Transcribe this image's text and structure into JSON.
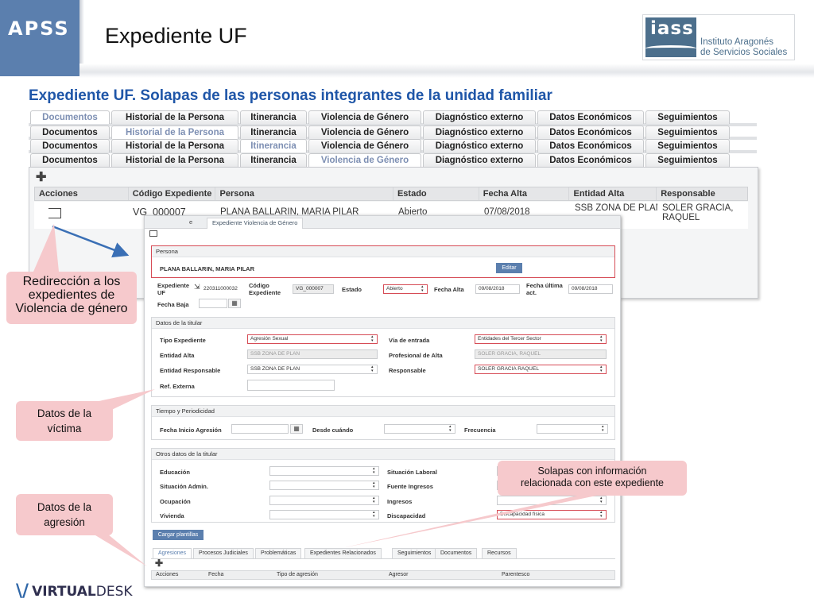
{
  "header": {
    "brand": "APSS",
    "title": "Expediente UF",
    "iass_logo_text": "iass",
    "iass_name_line1": "Instituto Aragonés",
    "iass_name_line2": "de Servicios Sociales"
  },
  "subtitle": "Expediente UF. Solapas de las personas integrantes de la unidad familiar",
  "tab_bars": [
    {
      "tabs": [
        "Documentos",
        "Historial de la Persona",
        "Itinerancia",
        "Violencia de Género",
        "Diagnóstico externo",
        "Datos Económicos",
        "Seguimientos"
      ],
      "active": 0
    },
    {
      "tabs": [
        "Documentos",
        "Historial de la Persona",
        "Itinerancia",
        "Violencia de Género",
        "Diagnóstico externo",
        "Datos Económicos",
        "Seguimientos"
      ],
      "active": 1
    },
    {
      "tabs": [
        "Documentos",
        "Historial de la Persona",
        "Itinerancia",
        "Violencia de Género",
        "Diagnóstico externo",
        "Datos Económicos",
        "Seguimientos"
      ],
      "active": 2
    },
    {
      "tabs": [
        "Documentos",
        "Historial de la Persona",
        "Itinerancia",
        "Violencia de Género",
        "Diagnóstico externo",
        "Datos Económicos",
        "Seguimientos"
      ],
      "active": 3
    }
  ],
  "grid": {
    "columns": [
      "Acciones",
      "Código Expediente",
      "Persona",
      "Estado",
      "Fecha Alta",
      "Entidad Alta",
      "Responsable"
    ],
    "row": {
      "codigo": "VG_000007",
      "persona": "PLANA BALLARIN, MARIA PILAR",
      "estado": "Abierto",
      "fecha_alta": "07/08/2018",
      "entidad_alta": "SSB ZONA DE PLAN",
      "responsable_1": "SOLER GRACIA,",
      "responsable_2": "RAQUEL"
    }
  },
  "form": {
    "tabs": [
      "e",
      "Expediente Violencia de Género"
    ],
    "persona_section": "Persona",
    "persona_name": "PLANA BALLARIN, MARIA PILAR",
    "edit_label": "Editar",
    "expediente_uf_label": "Expediente UF",
    "expediente_uf_value": "220311000032",
    "codigo_label": "Código Expediente",
    "codigo_value": "VG_000007",
    "estado_label": "Estado",
    "estado_value": "Abierto",
    "fecha_alta_label": "Fecha Alta",
    "fecha_alta_value": "09/08/2018",
    "fecha_ult_label": "Fecha última act.",
    "fecha_ult_value": "09/08/2018",
    "fecha_baja_label": "Fecha Baja",
    "titular_section": "Datos de la titular",
    "tipo_exp_label": "Tipo Expediente",
    "tipo_exp_value": "Agresión Sexual",
    "via_label": "Vía de entrada",
    "via_value": "Entidades del Tercer Sector",
    "entidad_alta_label": "Entidad Alta",
    "entidad_alta_value": "SSB ZONA DE PLAN",
    "prof_alta_label": "Profesional de Alta",
    "prof_alta_value": "SOLER GRACIA, RAQUEL",
    "entidad_resp_label": "Entidad Responsable",
    "entidad_resp_value": "SSB ZONA DE PLAN",
    "responsable_label": "Responsable",
    "responsable_value": "SOLER GRACIA RAQUEL",
    "ref_label": "Ref. Externa",
    "tiempo_section": "Tiempo y Periodicidad",
    "fecha_inicio_label": "Fecha Inicio Agresión",
    "desde_label": "Desde cuándo",
    "frecuencia_label": "Frecuencia",
    "otros_section": "Otros datos de la titular",
    "educacion_label": "Educación",
    "situacion_lab_label": "Situación Laboral",
    "situacion_adm_label": "Situación Admin.",
    "fuente_label": "Fuente Ingresos",
    "ocupacion_label": "Ocupación",
    "ingresos_label": "Ingresos",
    "vivienda_label": "Vivienda",
    "discapacidad_label": "Discapacidad",
    "discapacidad_value": "Discapacidad física",
    "cargar_label": "Cargar plantillas",
    "bottom_tabs": [
      "Agresiones",
      "Procesos Judiciales",
      "Problemáticas",
      "Expedientes Relacionados",
      "Seguimientos",
      "Documentos",
      "Recursos"
    ],
    "bottom_columns": [
      "Acciones",
      "Fecha",
      "Tipo de agresión",
      "Agresor",
      "Parentesco"
    ]
  },
  "callouts": {
    "redireccion_1": "Redirección a los",
    "redireccion_2": "expedientes de",
    "redireccion_3": "Violencia de género",
    "victima_1": "Datos de la",
    "victima_2": "víctima",
    "agresion_1": "Datos de la",
    "agresion_2": "agresión",
    "solapas_1": "Solapas con información",
    "solapas_2": "relacionada con este expediente"
  },
  "footer": {
    "logo_mark": "\\/",
    "logo_text_1": "VIRTUAL",
    "logo_text_2": "DESK"
  },
  "colors": {
    "brand_blue": "#5b7fae",
    "subtitle_blue": "#1f56a8",
    "callout_pink": "#f6c9cc",
    "required_red": "#d64c56",
    "arrow_blue": "#3a6fb5"
  }
}
